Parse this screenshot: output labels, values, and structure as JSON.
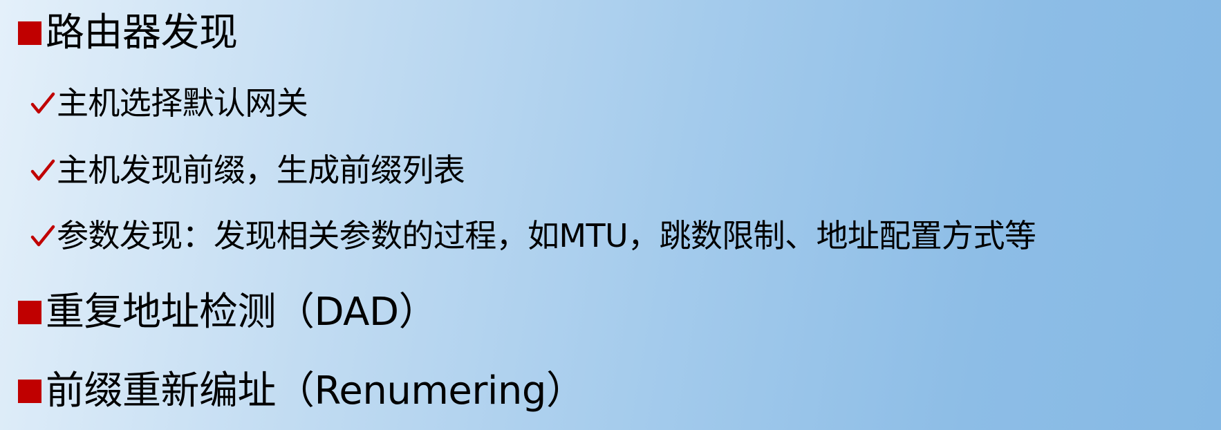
{
  "colors": {
    "bullet": "#c00000",
    "text": "#000000",
    "background_left": "#e4f0fa",
    "background_right": "#86b9e4"
  },
  "items": [
    {
      "level": 1,
      "icon": "square-bullet-icon",
      "text": "路由器发现"
    },
    {
      "level": 2,
      "icon": "checkmark-icon",
      "text": "主机选择默认网关"
    },
    {
      "level": 2,
      "icon": "checkmark-icon",
      "text": "主机发现前缀，生成前缀列表"
    },
    {
      "level": 2,
      "icon": "checkmark-icon",
      "text": "参数发现：发现相关参数的过程，如MTU，跳数限制、地址配置方式等"
    },
    {
      "level": 1,
      "icon": "square-bullet-icon",
      "text": "重复地址检测（DAD）"
    },
    {
      "level": 1,
      "icon": "square-bullet-icon",
      "text": "前缀重新编址（Renumering）"
    }
  ]
}
